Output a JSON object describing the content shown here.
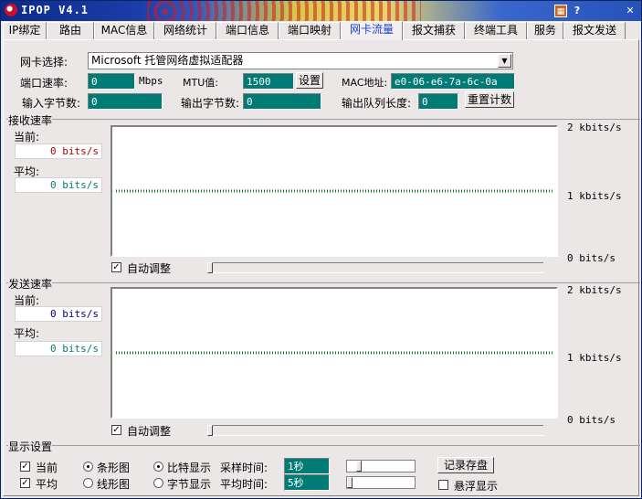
{
  "window": {
    "title": "IPOP V4.1",
    "help": "?",
    "close": "✕"
  },
  "tabs": [
    "IP绑定",
    "路由",
    "MAC信息",
    "网络统计",
    "端口信息",
    "端口映射",
    "网卡流量",
    "报文捕获",
    "终端工具",
    "服务",
    "报文发送"
  ],
  "active_tab": "网卡流量",
  "nic": {
    "select_label": "网卡选择:",
    "selected": "Microsoft 托管网络虚拟适配器",
    "port_speed_label": "端口速率:",
    "port_speed_value": "0",
    "port_speed_unit": "Mbps",
    "mtu_label": "MTU值:",
    "mtu_value": "1500",
    "set_button": "设置",
    "mac_label": "MAC地址:",
    "mac_value": "e0-06-e6-7a-6c-0a",
    "in_bytes_label": "输入字节数:",
    "in_bytes_value": "0",
    "out_bytes_label": "输出字节数:",
    "out_bytes_value": "0",
    "queue_label": "输出队列长度:",
    "queue_value": "0",
    "reset_button": "重置计数"
  },
  "recv": {
    "title": "接收速率",
    "current_label": "当前:",
    "current_value": "0  bits/s",
    "avg_label": "平均:",
    "avg_value": "0  bits/s",
    "auto_label": "自动调整",
    "auto_checked": true,
    "axis_top": "2  kbits/s",
    "axis_mid": "1  kbits/s",
    "axis_bottom": "0   bits/s",
    "current_color": "#b00000",
    "avg_color": "#007a74"
  },
  "send": {
    "title": "发送速率",
    "current_label": "当前:",
    "current_value": "0  bits/s",
    "avg_label": "平均:",
    "avg_value": "0  bits/s",
    "auto_label": "自动调整",
    "auto_checked": true,
    "axis_top": "2  kbits/s",
    "axis_mid": "1  kbits/s",
    "axis_bottom": "0   bits/s",
    "current_color": "#00007a",
    "avg_color": "#007a74"
  },
  "display": {
    "title": "显示设置",
    "chk_current": "当前",
    "chk_avg": "平均",
    "radio_bar": "条形图",
    "radio_line": "线形图",
    "radio_bits": "比特显示",
    "radio_bytes": "字节显示",
    "sample_label": "采样时间:",
    "sample_value": "1秒",
    "avg_time_label": "平均时间:",
    "avg_time_value": "5秒",
    "save_button": "记录存盘",
    "float_label": "悬浮显示"
  },
  "colors": {
    "graph_line": "#0a7a2a",
    "teal": "#007a74",
    "active_tab_text": "#1a3fd0"
  }
}
